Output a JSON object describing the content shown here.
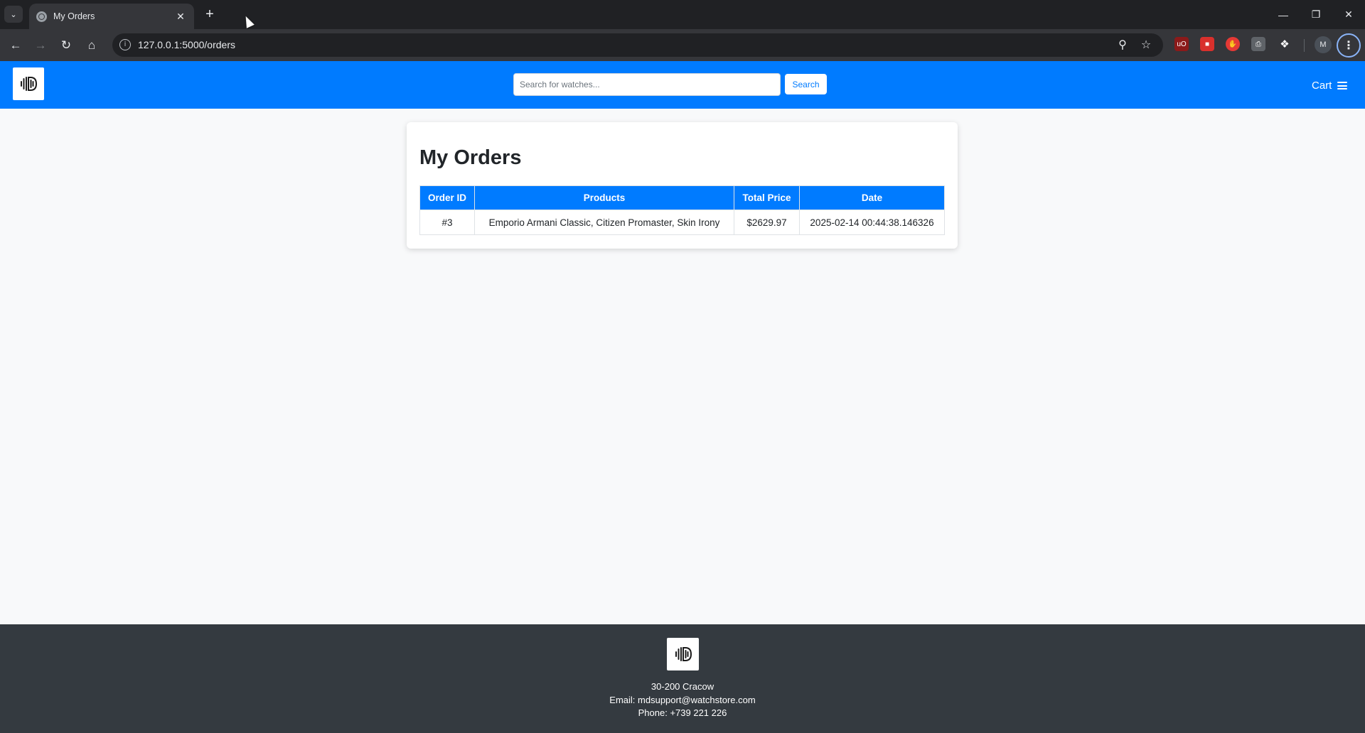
{
  "browser": {
    "tab_title": "My Orders",
    "url": "127.0.0.1:5000/orders",
    "profile_initial": "M"
  },
  "header": {
    "search_placeholder": "Search for watches...",
    "search_button": "Search",
    "cart_label": "Cart"
  },
  "main": {
    "title": "My Orders",
    "table": {
      "headers": [
        "Order ID",
        "Products",
        "Total Price",
        "Date"
      ],
      "rows": [
        {
          "order_id": "#3",
          "products": "Emporio Armani Classic, Citizen Promaster, Skin Irony",
          "total_price": "$2629.97",
          "date": "2025-02-14 00:44:38.146326"
        }
      ]
    }
  },
  "footer": {
    "address": "30-200 Cracow",
    "email": "Email: mdsupport@watchstore.com",
    "phone": "Phone: +739 221 226"
  },
  "colors": {
    "primary": "#007bff",
    "footer_bg": "#343a40",
    "page_bg": "#f8f9fa"
  }
}
